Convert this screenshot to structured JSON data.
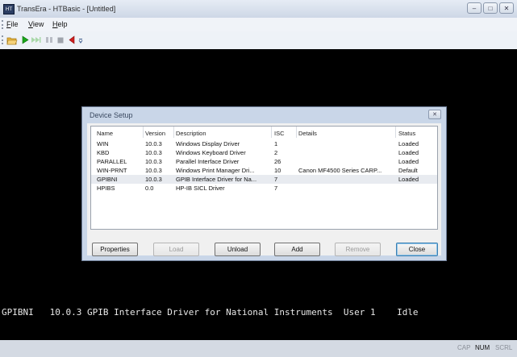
{
  "window": {
    "title": "TransEra - HTBasic - [Untitled]",
    "icon_text": "HT"
  },
  "window_controls": {
    "minimize": "–",
    "maximize": "□",
    "close": "✕"
  },
  "menu": [
    {
      "label": "File",
      "accel": "F"
    },
    {
      "label": "View",
      "accel": "V"
    },
    {
      "label": "Help",
      "accel": "H"
    }
  ],
  "toolbar": {
    "icons": [
      "open-folder-icon",
      "run-icon",
      "continue-icon",
      "pause-icon",
      "stop-icon",
      "step-back-icon",
      "overflow-chevron-icon"
    ],
    "colors": {
      "run": "#1aa61a",
      "stop": "#d11e1e",
      "folder": "#e6b43c"
    }
  },
  "terminal": {
    "status_line": "GPIBNI   10.0.3 GPIB Interface Driver for National Instruments  User 1    Idle"
  },
  "dialog": {
    "title": "Device Setup",
    "close": "✕",
    "columns": [
      "Name",
      "Version",
      "Description",
      "ISC",
      "Details",
      "Status"
    ],
    "rows": [
      {
        "name": "WIN",
        "version": "10.0.3",
        "description": "Windows Display Driver",
        "isc": "1",
        "details": "",
        "status": "Loaded"
      },
      {
        "name": "KBD",
        "version": "10.0.3",
        "description": "Windows Keyboard Driver",
        "isc": "2",
        "details": "",
        "status": "Loaded"
      },
      {
        "name": "PARALLEL",
        "version": "10.0.3",
        "description": "Parallel Interface Driver",
        "isc": "26",
        "details": "",
        "status": "Loaded"
      },
      {
        "name": "WIN-PRNT",
        "version": "10.0.3",
        "description": "Windows Print Manager Dri...",
        "isc": "10",
        "details": "Canon MF4500 Series CARP...",
        "status": "Default"
      },
      {
        "name": "GPIBNI",
        "version": "10.0.3",
        "description": "GPIB Interface Driver for Na...",
        "isc": "7",
        "details": "",
        "status": "Loaded"
      },
      {
        "name": "HPIBS",
        "version": "0.0",
        "description": "HP-IB SICL Driver",
        "isc": "7",
        "details": "",
        "status": ""
      }
    ],
    "selected_row": 4,
    "buttons": {
      "properties": "Properties",
      "load": "Load",
      "unload": "Unload",
      "add": "Add",
      "remove": "Remove",
      "close": "Close"
    }
  },
  "statusbar": {
    "cap": "CAP",
    "num": "NUM",
    "scrl": "SCRL"
  }
}
